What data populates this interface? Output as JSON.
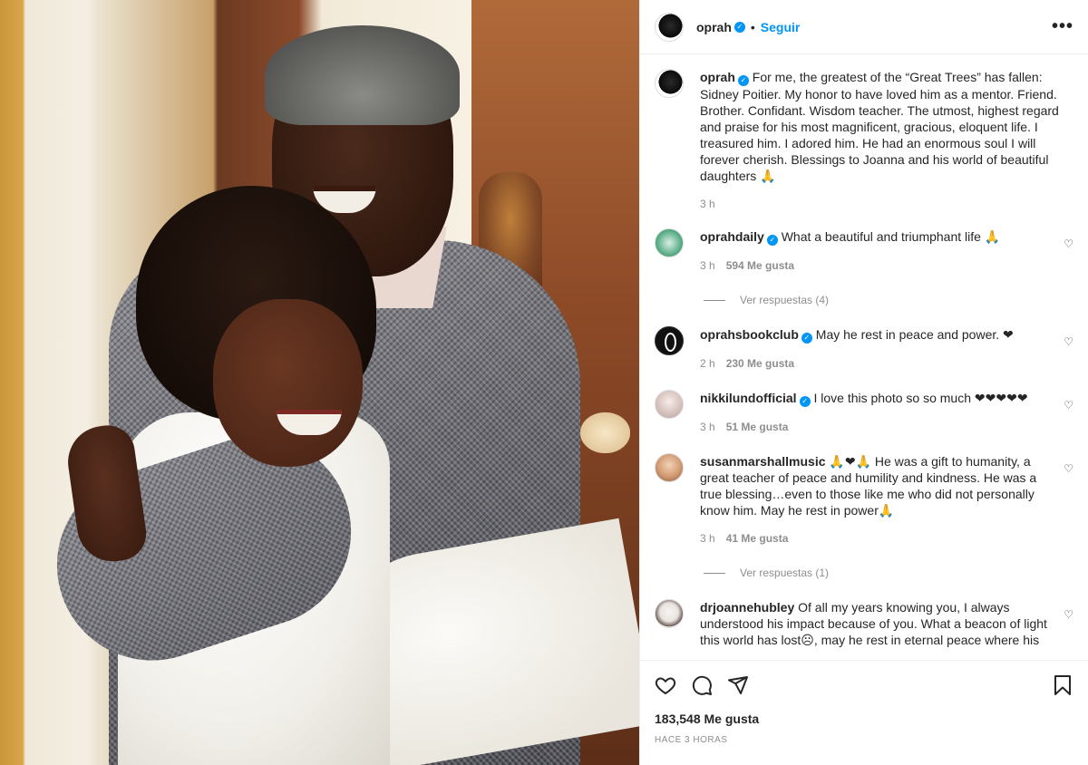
{
  "post": {
    "username": "oprah",
    "follow_label": "Seguir",
    "separator": "•",
    "more_label": "•••"
  },
  "caption": {
    "username": "oprah",
    "text": "For me, the greatest of the “Great Trees” has fallen: Sidney Poitier. My honor to have loved him as a mentor. Friend. Brother. Confidant. Wisdom teacher. The utmost, highest regard and praise for his most magnificent, gracious, eloquent life. I treasured him. I adored him. He had an enormous soul I will forever cherish. Blessings to Joanna and his world of beautiful daughters 🙏",
    "time": "3 h"
  },
  "comments": [
    {
      "username": "oprahdaily",
      "verified": true,
      "text": "What a beautiful and triumphant life 🙏",
      "time": "3 h",
      "likes": "594 Me gusta",
      "replies": "Ver respuestas (4)"
    },
    {
      "username": "oprahsbookclub",
      "verified": true,
      "text": "May he rest in peace and power. ❤",
      "time": "2 h",
      "likes": "230 Me gusta"
    },
    {
      "username": "nikkilundofficial",
      "verified": true,
      "text": "I love this photo so so much ❤❤❤❤❤",
      "time": "3 h",
      "likes": "51 Me gusta"
    },
    {
      "username": "susanmarshallmusic",
      "verified": false,
      "text": "🙏❤🙏 He was a gift to humanity, a great teacher of peace and humility and kindness. He was a true blessing…even to those like me who did not personally know him. May he rest in power🙏",
      "time": "3 h",
      "likes": "41 Me gusta",
      "replies": "Ver respuestas (1)"
    },
    {
      "username": "drjoannehubley",
      "verified": false,
      "text": "Of all my years knowing you, I always understood his impact because of you. What a beacon of light this world has lost☹, may he rest in eternal peace where his"
    }
  ],
  "footer": {
    "likes": "183,548 Me gusta",
    "timestamp": "HACE 3 HORAS"
  },
  "icons": [
    "heart-icon",
    "comment-icon",
    "share-icon",
    "bookmark-icon",
    "verified-badge-icon",
    "more-options-icon"
  ],
  "colors": {
    "accent": "#0095f6",
    "text": "#262626",
    "muted": "#8e8e8e",
    "border": "#efefef"
  }
}
